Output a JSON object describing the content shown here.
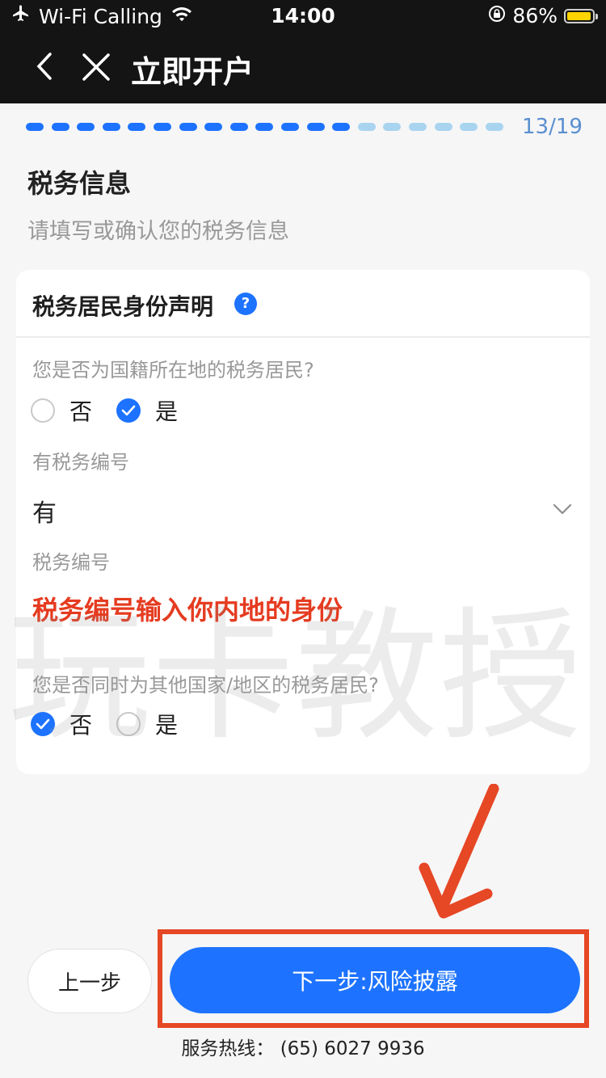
{
  "status_bar": {
    "carrier": "Wi-Fi Calling",
    "time": "14:00",
    "battery_percent": "86%"
  },
  "nav": {
    "title": "立即开户"
  },
  "progress": {
    "current": 13,
    "total": 19,
    "label": "13/19"
  },
  "page": {
    "title": "税务信息",
    "subtitle": "请填写或确认您的税务信息"
  },
  "card": {
    "title": "税务居民身份声明",
    "help": "?",
    "q1": {
      "label": "您是否为国籍所在地的税务居民?",
      "options": [
        "否",
        "是"
      ],
      "selected": "是"
    },
    "tax_id_has": {
      "label": "有税务编号",
      "value": "有"
    },
    "tax_id": {
      "label": "税务编号",
      "note": "税务编号输入你内地的身份"
    },
    "q2": {
      "label": "您是否同时为其他国家/地区的税务居民?",
      "options": [
        "否",
        "是"
      ],
      "selected": "否"
    }
  },
  "watermark": "玩卡教授",
  "buttons": {
    "prev": "上一步",
    "next": "下一步:风险披露"
  },
  "hotline": "服务热线： (65) 6027 9936",
  "colors": {
    "primary": "#1d73ff",
    "annotation_red": "#e64725",
    "progress_done": "#1d73ff",
    "progress_todo": "#a8d4f0"
  }
}
